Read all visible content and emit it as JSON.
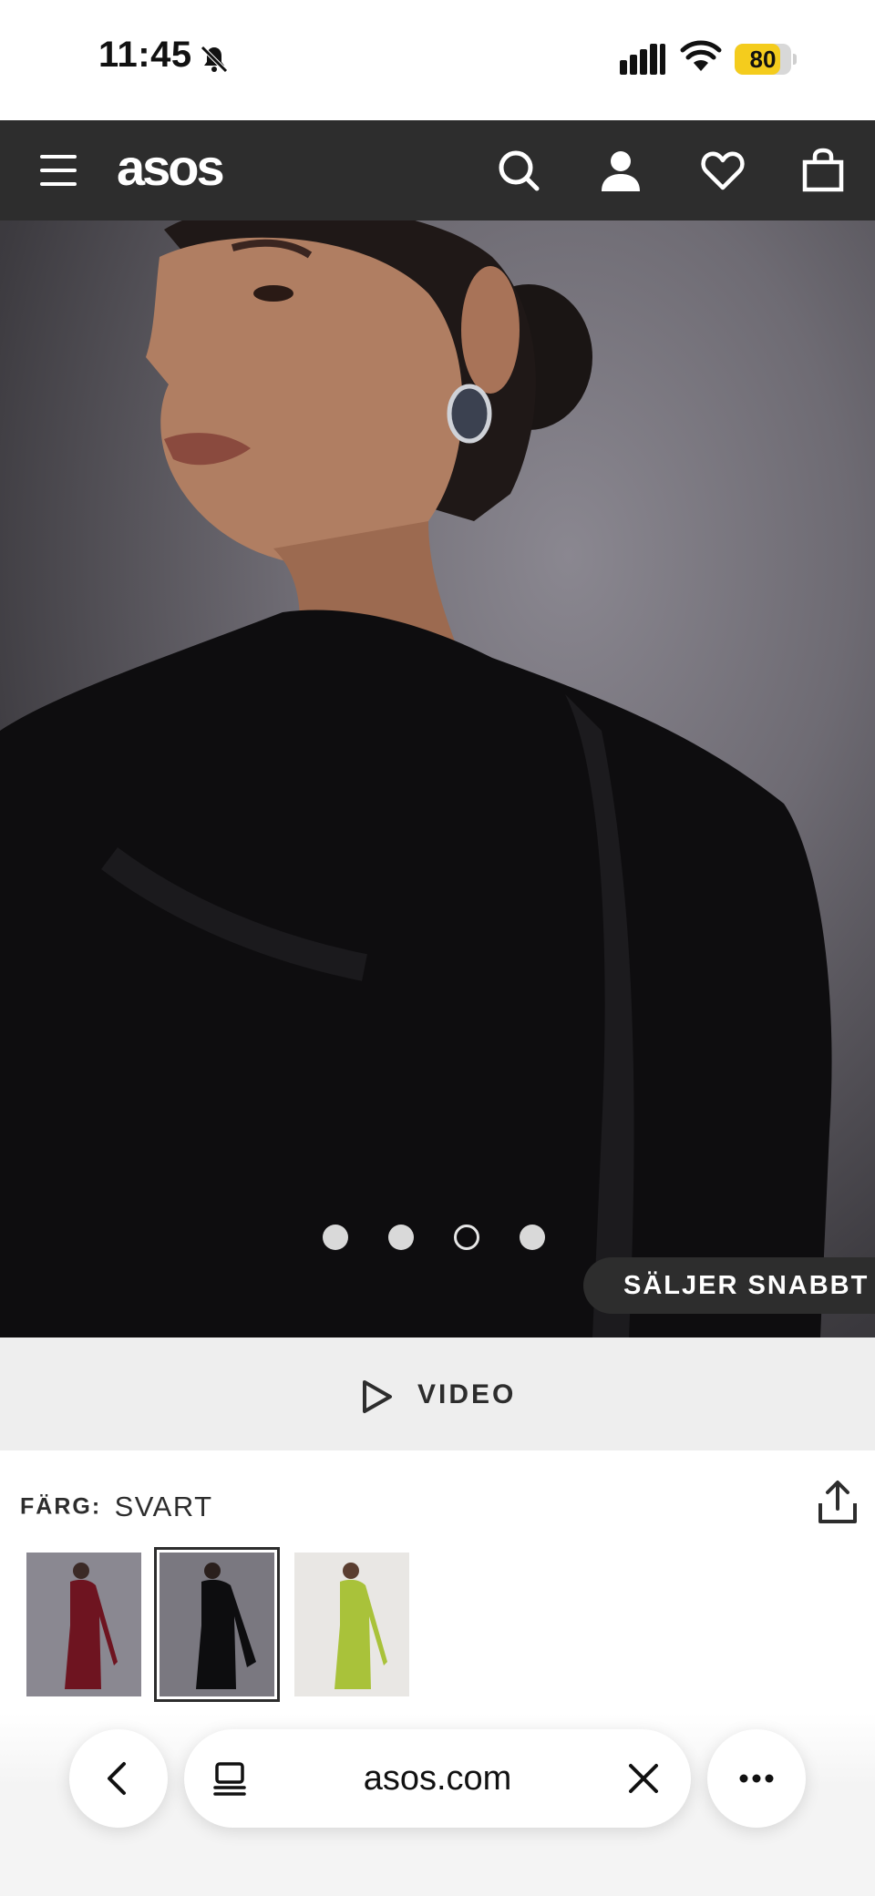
{
  "status_bar": {
    "time": "11:45",
    "battery_level": "80",
    "battery_color": "#f4cc1d",
    "icons": [
      "bell-slash-icon",
      "cellular-signal-icon",
      "wifi-icon",
      "battery-icon"
    ]
  },
  "header": {
    "logo": "asos",
    "background": "#2d2d2d",
    "icons": [
      "hamburger-menu-icon",
      "search-icon",
      "account-icon",
      "heart-icon",
      "bag-icon"
    ]
  },
  "hero": {
    "badge": "SÄLJER SNABBT",
    "carousel": {
      "count": 4,
      "active_index": 2
    }
  },
  "video_bar": {
    "label": "VIDEO",
    "icon": "play-icon"
  },
  "product": {
    "color_label": "FÄRG:",
    "color_value": "SVART",
    "swatches": [
      {
        "color_name": "burgundy",
        "hex": "#6e1420",
        "selected": false
      },
      {
        "color_name": "black",
        "hex": "#0d0d0f",
        "selected": true
      },
      {
        "color_name": "lime",
        "hex": "#a9c23a",
        "selected": false
      }
    ]
  },
  "browser": {
    "url": "asos.com",
    "icons": [
      "back-chevron-icon",
      "tabs-icon",
      "close-icon",
      "more-icon"
    ]
  }
}
